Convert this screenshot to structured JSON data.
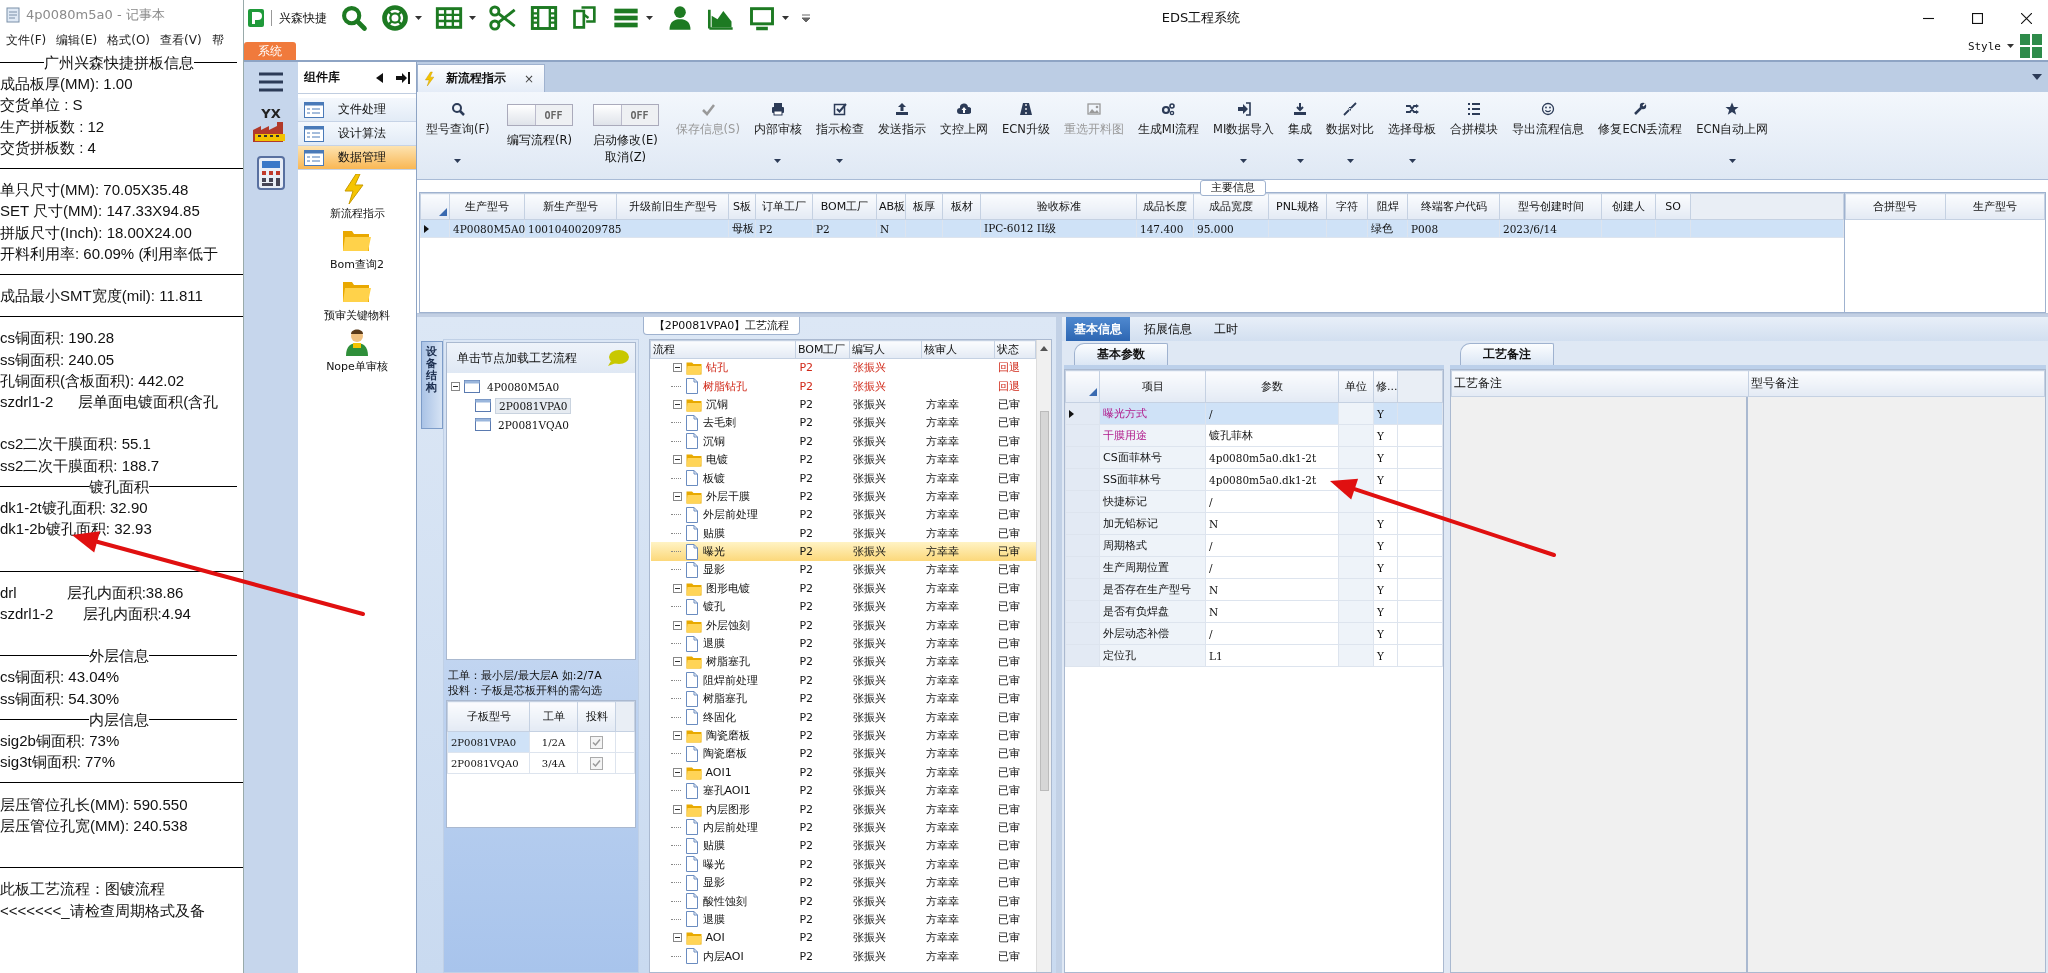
{
  "notepad": {
    "title": "4p0080m5a0 - 记事本",
    "menu": [
      "文件(F)",
      "编辑(E)",
      "格式(O)",
      "查看(V)",
      "帮"
    ],
    "lines": [
      {
        "kind": "heading",
        "text": "广州兴森快捷拼板信息"
      },
      {
        "kind": "text",
        "text": "成品板厚(MM): 1.00"
      },
      {
        "kind": "text",
        "text": "交货单位 : S"
      },
      {
        "kind": "text",
        "text": "生产拼板数 : 12"
      },
      {
        "kind": "text",
        "text": "交货拼板数 : 4"
      },
      {
        "kind": "rule"
      },
      {
        "kind": "text",
        "text": "单只尺寸(MM): 70.05X35.48"
      },
      {
        "kind": "text",
        "text": "SET 尺寸(MM): 147.33X94.85"
      },
      {
        "kind": "text",
        "text": "拼版尺寸(Inch): 18.00X24.00"
      },
      {
        "kind": "text",
        "text": "开料利用率: 60.09% (利用率低于"
      },
      {
        "kind": "rule"
      },
      {
        "kind": "text",
        "text": "成品最小SMT宽度(mil): 11.811"
      },
      {
        "kind": "rule"
      },
      {
        "kind": "text",
        "text": "cs铜面积: 190.28"
      },
      {
        "kind": "text",
        "text": "ss铜面积: 240.05"
      },
      {
        "kind": "text",
        "text": "孔铜面积(含板面积): 442.02"
      },
      {
        "kind": "text",
        "text": "szdrl1-2      层单面电镀面积(含孔"
      },
      {
        "kind": "blank"
      },
      {
        "kind": "text",
        "text": "cs2二次干膜面积: 55.1"
      },
      {
        "kind": "text",
        "text": "ss2二次干膜面积: 188.7"
      },
      {
        "kind": "heading",
        "text": "镀孔面积"
      },
      {
        "kind": "text",
        "text": "dk1-2t镀孔面积: 32.90"
      },
      {
        "kind": "text",
        "text": "dk1-2b镀孔面积: 32.93"
      },
      {
        "kind": "blank"
      },
      {
        "kind": "rule"
      },
      {
        "kind": "text",
        "text": "drl            层孔内面积:38.86"
      },
      {
        "kind": "text",
        "text": "szdrl1-2       层孔内面积:4.94"
      },
      {
        "kind": "blank"
      },
      {
        "kind": "heading",
        "text": "外层信息"
      },
      {
        "kind": "text",
        "text": "cs铜面积: 43.04%"
      },
      {
        "kind": "text",
        "text": "ss铜面积: 54.30%"
      },
      {
        "kind": "heading",
        "text": "内层信息"
      },
      {
        "kind": "text",
        "text": "sig2b铜面积: 73%"
      },
      {
        "kind": "text",
        "text": "sig3t铜面积: 77%"
      },
      {
        "kind": "rule"
      },
      {
        "kind": "text",
        "text": "层压管位孔长(MM): 590.550"
      },
      {
        "kind": "text",
        "text": "层压管位孔宽(MM): 240.538"
      },
      {
        "kind": "blank"
      },
      {
        "kind": "rule"
      },
      {
        "kind": "text",
        "text": "此板工艺流程：图镀流程"
      },
      {
        "kind": "text",
        "text": "<<<<<<<_请检查周期格式及备"
      }
    ]
  },
  "window": {
    "title": "EDS工程系统",
    "brand": "兴森快捷",
    "system_tab": "系统",
    "style_menu": "Style",
    "nav_badge": "YX"
  },
  "component_library": {
    "title": "组件库",
    "categories": [
      {
        "label": "文件处理",
        "selected": false
      },
      {
        "label": "设计算法",
        "selected": false
      },
      {
        "label": "数据管理",
        "selected": true
      }
    ],
    "tools": [
      {
        "label": "新流程指示"
      },
      {
        "label": "Bom查询2"
      },
      {
        "label": "预审关键物料"
      },
      {
        "label": "Nope单审核"
      }
    ]
  },
  "document_tab": {
    "label": "新流程指示",
    "close": "×"
  },
  "ribbon": [
    {
      "kind": "button",
      "label": [
        "型号查询(F)"
      ],
      "dropdown": true,
      "disabled": false
    },
    {
      "kind": "toggle",
      "label": [
        "编写流程(R)"
      ],
      "switch_text": "OFF",
      "on": false
    },
    {
      "kind": "toggle",
      "label": [
        "启动修改(E)",
        "取消(Z)"
      ],
      "switch_text": "OFF",
      "on": false
    },
    {
      "kind": "button",
      "label": [
        "保存信息(S)"
      ],
      "dropdown": false,
      "disabled": true
    },
    {
      "kind": "button",
      "label": [
        "内部审核"
      ],
      "dropdown": true,
      "disabled": false
    },
    {
      "kind": "button",
      "label": [
        "指示检查"
      ],
      "dropdown": true,
      "disabled": false
    },
    {
      "kind": "button",
      "label": [
        "发送指示"
      ],
      "dropdown": false,
      "disabled": false
    },
    {
      "kind": "button",
      "label": [
        "文控上网"
      ],
      "dropdown": false,
      "disabled": false
    },
    {
      "kind": "button",
      "label": [
        "ECN升级"
      ],
      "dropdown": false,
      "disabled": false
    },
    {
      "kind": "button",
      "label": [
        "重选开料图"
      ],
      "dropdown": false,
      "disabled": true
    },
    {
      "kind": "button",
      "label": [
        "生成MI流程"
      ],
      "dropdown": false,
      "disabled": false
    },
    {
      "kind": "button",
      "label": [
        "MI数据导入"
      ],
      "dropdown": true,
      "disabled": false
    },
    {
      "kind": "button",
      "label": [
        "集成"
      ],
      "dropdown": true,
      "disabled": false
    },
    {
      "kind": "button",
      "label": [
        "数据对比"
      ],
      "dropdown": true,
      "disabled": false
    },
    {
      "kind": "button",
      "label": [
        "选择母板"
      ],
      "dropdown": true,
      "disabled": false
    },
    {
      "kind": "button",
      "label": [
        "合拼模块"
      ],
      "dropdown": false,
      "disabled": false
    },
    {
      "kind": "button",
      "label": [
        "导出流程信息"
      ],
      "dropdown": false,
      "disabled": false
    },
    {
      "kind": "button",
      "label": [
        "修复ECN丢流程"
      ],
      "dropdown": false,
      "disabled": false
    },
    {
      "kind": "button",
      "label": [
        "ECN自动上网"
      ],
      "dropdown": true,
      "disabled": false
    }
  ],
  "main_info": {
    "title": "主要信息",
    "columns": [
      "生产型号",
      "新生产型号",
      "升级前旧生产型号",
      "S板",
      "订单工厂",
      "BOM工厂",
      "AB板",
      "板厚",
      "板材",
      "验收标准",
      "成品长度",
      "成品宽度",
      "PNL规格",
      "字符",
      "阻焊",
      "终端客户代码",
      "型号创建时间",
      "创建人",
      "SO"
    ],
    "rows": [
      {
        "selected": true,
        "cells": [
          "4P0080M5A0",
          "10010400209785",
          null,
          "母板",
          "P2",
          "P2",
          "N",
          null,
          null,
          "IPC-6012 II级",
          "147.400",
          "95.000",
          null,
          null,
          "绿色",
          "P008",
          "2023/6/14",
          null,
          null
        ]
      }
    ],
    "merge_columns": [
      "合拼型号",
      "生产型号"
    ]
  },
  "process_panel": {
    "title": "【2P0081VPA0】工艺流程",
    "side_tab": "设备结构",
    "tree_hint": "单击节点加载工艺流程",
    "tree": [
      {
        "label": "4P0080M5A0",
        "expanded": true,
        "selected": false,
        "children": [
          {
            "label": "2P0081VPA0",
            "selected": true
          },
          {
            "label": "2P0081VQA0",
            "selected": false
          }
        ]
      }
    ],
    "notes": [
      "工单：最小层/最大层A 如:2/7A",
      "投料：子板是芯板开料的需勾选"
    ],
    "sub_boards": {
      "columns": [
        "子板型号",
        "工单",
        "投料"
      ],
      "rows": [
        {
          "cells": [
            "2P0081VPA0",
            "1/2A"
          ],
          "checked": true,
          "selected": true
        },
        {
          "cells": [
            "2P0081VQA0",
            "3/4A"
          ],
          "checked": true,
          "selected": false
        }
      ]
    },
    "flow": {
      "columns": [
        "流程",
        "BOM工厂",
        "编写人",
        "核审人",
        "状态"
      ],
      "rows": [
        {
          "name": "钻孔",
          "bom": "P2",
          "writer": "张振兴",
          "status": "回退",
          "returned": true,
          "selected": false,
          "expanded": true,
          "children": [
            {
              "name": "树脂钻孔",
              "bom": "P2",
              "writer": "张振兴",
              "status": "回退",
              "returned": true,
              "selected": false
            }
          ]
        },
        {
          "name": "沉铜",
          "bom": "P2",
          "writer": "张振兴",
          "reviewer": "方幸幸",
          "status": "已审",
          "returned": false,
          "selected": false,
          "expanded": true,
          "children": [
            {
              "name": "去毛刺",
              "bom": "P2",
              "writer": "张振兴",
              "reviewer": "方幸幸",
              "status": "已审",
              "returned": false,
              "selected": false
            },
            {
              "name": "沉铜",
              "bom": "P2",
              "writer": "张振兴",
              "reviewer": "方幸幸",
              "status": "已审",
              "returned": false,
              "selected": false
            }
          ]
        },
        {
          "name": "电镀",
          "bom": "P2",
          "writer": "张振兴",
          "reviewer": "方幸幸",
          "status": "已审",
          "returned": false,
          "selected": false,
          "expanded": true,
          "children": [
            {
              "name": "板镀",
              "bom": "P2",
              "writer": "张振兴",
              "reviewer": "方幸幸",
              "status": "已审",
              "returned": false,
              "selected": false
            }
          ]
        },
        {
          "name": "外层干膜",
          "bom": "P2",
          "writer": "张振兴",
          "reviewer": "方幸幸",
          "status": "已审",
          "returned": false,
          "selected": false,
          "expanded": true,
          "children": [
            {
              "name": "外层前处理",
              "bom": "P2",
              "writer": "张振兴",
              "reviewer": "方幸幸",
              "status": "已审",
              "returned": false,
              "selected": false
            },
            {
              "name": "贴膜",
              "bom": "P2",
              "writer": "张振兴",
              "reviewer": "方幸幸",
              "status": "已审",
              "returned": false,
              "selected": false
            },
            {
              "name": "曝光",
              "bom": "P2",
              "writer": "张振兴",
              "reviewer": "方幸幸",
              "status": "已审",
              "returned": false,
              "selected": true
            },
            {
              "name": "显影",
              "bom": "P2",
              "writer": "张振兴",
              "reviewer": "方幸幸",
              "status": "已审",
              "returned": false,
              "selected": false
            }
          ]
        },
        {
          "name": "图形电镀",
          "bom": "P2",
          "writer": "张振兴",
          "reviewer": "方幸幸",
          "status": "已审",
          "returned": false,
          "selected": false,
          "expanded": true,
          "children": [
            {
              "name": "镀孔",
              "bom": "P2",
              "writer": "张振兴",
              "reviewer": "方幸幸",
              "status": "已审",
              "returned": false,
              "selected": false
            }
          ]
        },
        {
          "name": "外层蚀刻",
          "bom": "P2",
          "writer": "张振兴",
          "reviewer": "方幸幸",
          "status": "已审",
          "returned": false,
          "selected": false,
          "expanded": true,
          "children": [
            {
              "name": "退膜",
              "bom": "P2",
              "writer": "张振兴",
              "reviewer": "方幸幸",
              "status": "已审",
              "returned": false,
              "selected": false
            }
          ]
        },
        {
          "name": "树脂塞孔",
          "bom": "P2",
          "writer": "张振兴",
          "reviewer": "方幸幸",
          "status": "已审",
          "returned": false,
          "selected": false,
          "expanded": true,
          "children": [
            {
              "name": "阻焊前处理",
              "bom": "P2",
              "writer": "张振兴",
              "reviewer": "方幸幸",
              "status": "已审",
              "returned": false,
              "selected": false
            },
            {
              "name": "树脂塞孔",
              "bom": "P2",
              "writer": "张振兴",
              "reviewer": "方幸幸",
              "status": "已审",
              "returned": false,
              "selected": false
            },
            {
              "name": "终固化",
              "bom": "P2",
              "writer": "张振兴",
              "reviewer": "方幸幸",
              "status": "已审",
              "returned": false,
              "selected": false
            }
          ]
        },
        {
          "name": "陶瓷磨板",
          "bom": "P2",
          "writer": "张振兴",
          "reviewer": "方幸幸",
          "status": "已审",
          "returned": false,
          "selected": false,
          "expanded": true,
          "children": [
            {
              "name": "陶瓷磨板",
              "bom": "P2",
              "writer": "张振兴",
              "reviewer": "方幸幸",
              "status": "已审",
              "returned": false,
              "selected": false
            }
          ]
        },
        {
          "name": "AOI1",
          "bom": "P2",
          "writer": "张振兴",
          "reviewer": "方幸幸",
          "status": "已审",
          "returned": false,
          "selected": false,
          "expanded": true,
          "children": [
            {
              "name": "塞孔AOI1",
              "bom": "P2",
              "writer": "张振兴",
              "reviewer": "方幸幸",
              "status": "已审",
              "returned": false,
              "selected": false
            }
          ]
        },
        {
          "name": "内层图形",
          "bom": "P2",
          "writer": "张振兴",
          "reviewer": "方幸幸",
          "status": "已审",
          "returned": false,
          "selected": false,
          "expanded": true,
          "children": [
            {
              "name": "内层前处理",
              "bom": "P2",
              "writer": "张振兴",
              "reviewer": "方幸幸",
              "status": "已审",
              "returned": false,
              "selected": false
            },
            {
              "name": "贴膜",
              "bom": "P2",
              "writer": "张振兴",
              "reviewer": "方幸幸",
              "status": "已审",
              "returned": false,
              "selected": false
            },
            {
              "name": "曝光",
              "bom": "P2",
              "writer": "张振兴",
              "reviewer": "方幸幸",
              "status": "已审",
              "returned": false,
              "selected": false
            },
            {
              "name": "显影",
              "bom": "P2",
              "writer": "张振兴",
              "reviewer": "方幸幸",
              "status": "已审",
              "returned": false,
              "selected": false
            },
            {
              "name": "酸性蚀刻",
              "bom": "P2",
              "writer": "张振兴",
              "reviewer": "方幸幸",
              "status": "已审",
              "returned": false,
              "selected": false
            },
            {
              "name": "退膜",
              "bom": "P2",
              "writer": "张振兴",
              "reviewer": "方幸幸",
              "status": "已审",
              "returned": false,
              "selected": false
            }
          ]
        },
        {
          "name": "AOI",
          "bom": "P2",
          "writer": "张振兴",
          "reviewer": "方幸幸",
          "status": "已审",
          "returned": false,
          "selected": false,
          "expanded": true,
          "children": [
            {
              "name": "内层AOI",
              "bom": "P2",
              "writer": "张振兴",
              "reviewer": "方幸幸",
              "status": "已审",
              "returned": false,
              "selected": false
            }
          ]
        }
      ]
    }
  },
  "detail": {
    "tabs": [
      {
        "label": "基本信息",
        "selected": true
      },
      {
        "label": "拓展信息",
        "selected": false
      },
      {
        "label": "工时",
        "selected": false
      }
    ],
    "params_tab": "基本参数",
    "param_columns": [
      "项目",
      "参数",
      "单位",
      "修..."
    ],
    "params": [
      {
        "item": "曝光方式",
        "value": "/",
        "edit": "Y",
        "flagged": true,
        "selected": true
      },
      {
        "item": "干膜用途",
        "value": "镀孔菲林",
        "edit": "Y",
        "flagged": true,
        "selected": false
      },
      {
        "item": "CS面菲林号",
        "value": "4p0080m5a0.dk1-2t",
        "edit": "Y",
        "flagged": false,
        "selected": false
      },
      {
        "item": "SS面菲林号",
        "value": "4p0080m5a0.dk1-2t",
        "edit": "Y",
        "flagged": false,
        "selected": false
      },
      {
        "item": "快捷标记",
        "value": "/",
        "flagged": false,
        "selected": false
      },
      {
        "item": "加无铅标记",
        "value": "N",
        "edit": "Y",
        "flagged": false,
        "selected": false
      },
      {
        "item": "周期格式",
        "value": "/",
        "edit": "Y",
        "flagged": false,
        "selected": false
      },
      {
        "item": "生产周期位置",
        "value": "/",
        "edit": "Y",
        "flagged": false,
        "selected": false
      },
      {
        "item": "是否存在生产型号",
        "value": "N",
        "edit": "Y",
        "flagged": false,
        "selected": false
      },
      {
        "item": "是否有负焊盘",
        "value": "N",
        "edit": "Y",
        "flagged": false,
        "selected": false
      },
      {
        "item": "外层动态补偿",
        "value": "/",
        "edit": "Y",
        "flagged": false,
        "selected": false
      },
      {
        "item": "定位孔",
        "value": "L1",
        "edit": "Y",
        "flagged": false,
        "selected": false
      }
    ],
    "notes_tab": "工艺备注",
    "note_columns": [
      "工艺备注",
      "型号备注"
    ]
  },
  "annotations": [
    {
      "kind": "arrow"
    },
    {
      "kind": "arrow"
    }
  ]
}
